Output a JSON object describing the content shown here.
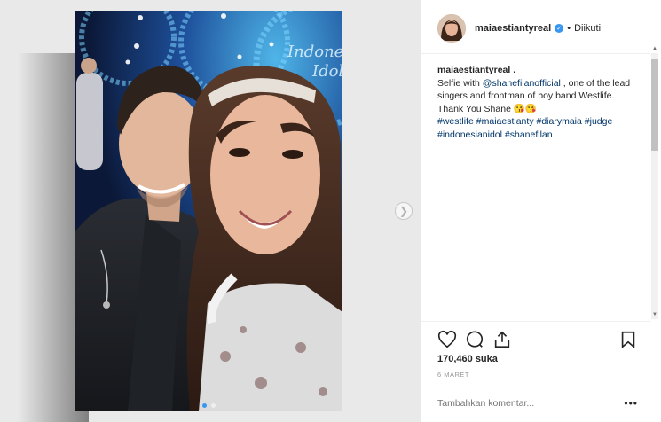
{
  "post": {
    "username": "maiaestiantyreal",
    "follow_status": "Diikuti",
    "caption": {
      "user": "maiaestiantyreal .",
      "text1": "Selfie with ",
      "mention": "@shanefilanofficial",
      "text2": " , one of the lead singers and frontman of boy band Westlife. Thank You Shane 😘😘",
      "hashtags": [
        "#westlife",
        "#maiaestianty",
        "#diarymaia",
        "#judge",
        "#indonesianidol",
        "#shanefilan"
      ]
    },
    "likes": "170,460 suka",
    "date": "6 MARET",
    "comment_placeholder": "Tambahkan komentar...",
    "more_label": "•••"
  },
  "photo": {
    "backdrop_text_line1": "Indonesian",
    "backdrop_text_line2": "Idol",
    "carousel_dots": 2,
    "active_dot": 0
  },
  "icons": [
    "heart-icon",
    "comment-icon",
    "share-icon",
    "bookmark-icon",
    "verified-icon",
    "chevron-right-icon"
  ],
  "colors": {
    "link": "#003569",
    "verified": "#3897f0",
    "muted": "#999999"
  }
}
